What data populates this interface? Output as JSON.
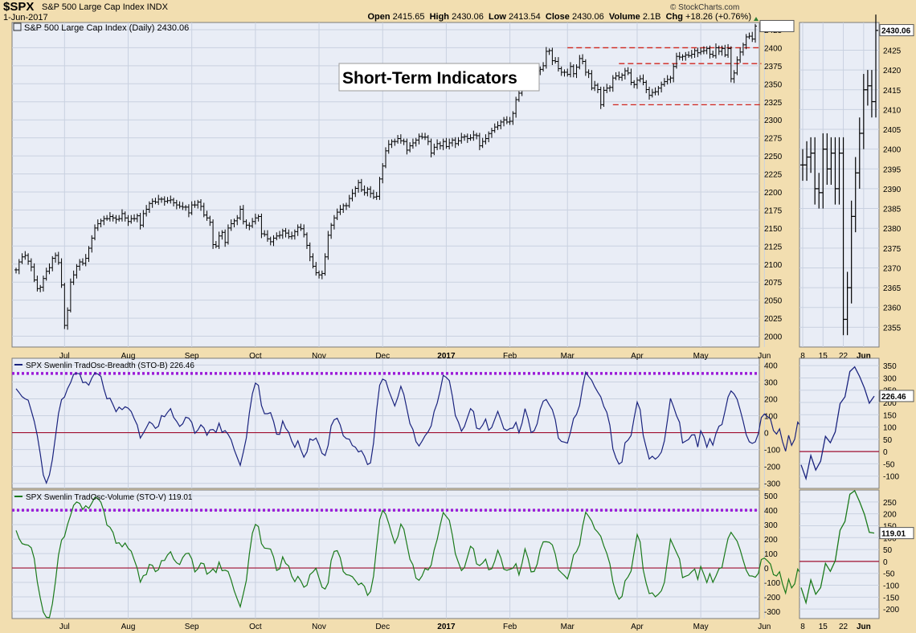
{
  "header": {
    "symbol": "$SPX",
    "name": "S&P 500 Large Cap Index  INDX",
    "date": "1-Jun-2017",
    "open_label": "Open",
    "open": "2415.65",
    "high_label": "High",
    "high": "2430.06",
    "low_label": "Low",
    "low": "2413.54",
    "close_label": "Close",
    "close": "2430.06",
    "volume_label": "Volume",
    "volume": "2.1B",
    "chg_label": "Chg",
    "chg": "+18.26 (+0.76%)",
    "brand": "© StockCharts.com"
  },
  "chart_data": [
    {
      "type": "ohlc",
      "title": "S&P 500 Large Cap Index (Daily) 2430.06",
      "annotation": "Short-Term Indicators",
      "x_labels": [
        "Jul",
        "Aug",
        "Sep",
        "Oct",
        "Nov",
        "Dec",
        "2017",
        "Feb",
        "Mar",
        "Apr",
        "May",
        "Jun"
      ],
      "ylim": [
        1985,
        2435
      ],
      "y_ticks": [
        2000,
        2025,
        2050,
        2075,
        2100,
        2125,
        2150,
        2175,
        2200,
        2225,
        2250,
        2275,
        2300,
        2325,
        2350,
        2375,
        2400,
        2425
      ],
      "grid": true,
      "last_value": 2430.06,
      "closes": [
        2092,
        2103,
        2110,
        2112,
        2104,
        2096,
        2078,
        2066,
        2068,
        2080,
        2090,
        2095,
        2108,
        2112,
        2102,
        2071,
        2015,
        2036,
        2075,
        2085,
        2097,
        2103,
        2101,
        2108,
        2122,
        2136,
        2150,
        2156,
        2160,
        2163,
        2163,
        2166,
        2164,
        2162,
        2163,
        2170,
        2164,
        2159,
        2163,
        2163,
        2167,
        2154,
        2170,
        2176,
        2184,
        2187,
        2186,
        2190,
        2190,
        2187,
        2188,
        2189,
        2185,
        2182,
        2180,
        2179,
        2179,
        2171,
        2182,
        2182,
        2186,
        2180,
        2168,
        2164,
        2158,
        2127,
        2125,
        2139,
        2144,
        2130,
        2150,
        2156,
        2160,
        2164,
        2176,
        2159,
        2154,
        2153,
        2159,
        2164,
        2166,
        2142,
        2141,
        2135,
        2131,
        2136,
        2139,
        2140,
        2146,
        2143,
        2138,
        2139,
        2145,
        2151,
        2149,
        2141,
        2126,
        2110,
        2097,
        2088,
        2085,
        2087,
        2110,
        2140,
        2154,
        2164,
        2172,
        2176,
        2181,
        2181,
        2191,
        2198,
        2205,
        2213,
        2203,
        2199,
        2204,
        2198,
        2193,
        2194,
        2218,
        2236,
        2257,
        2266,
        2270,
        2270,
        2274,
        2271,
        2270,
        2258,
        2264,
        2268,
        2272,
        2277,
        2276,
        2276,
        2270,
        2254,
        2262,
        2267,
        2264,
        2270,
        2263,
        2268,
        2272,
        2267,
        2271,
        2276,
        2277,
        2274,
        2275,
        2279,
        2278,
        2264,
        2270,
        2274,
        2281,
        2285,
        2290,
        2292,
        2297,
        2300,
        2297,
        2298,
        2309,
        2328,
        2337,
        2345,
        2352,
        2365,
        2363,
        2367,
        2368,
        2370,
        2375,
        2395,
        2396,
        2382,
        2381,
        2371,
        2366,
        2366,
        2363,
        2374,
        2364,
        2373,
        2385,
        2381,
        2366,
        2364,
        2344,
        2348,
        2342,
        2321,
        2341,
        2344,
        2345,
        2358,
        2361,
        2359,
        2362,
        2368,
        2365,
        2352,
        2349,
        2355,
        2357,
        2352,
        2342,
        2334,
        2338,
        2339,
        2344,
        2349,
        2353,
        2356,
        2358,
        2374,
        2388,
        2387,
        2388,
        2390,
        2389,
        2391,
        2396,
        2393,
        2395,
        2396,
        2399,
        2391,
        2389,
        2400,
        2395,
        2399,
        2390,
        2399,
        2357,
        2365,
        2383,
        2394,
        2404,
        2415,
        2416,
        2412,
        2430
      ]
    },
    {
      "type": "line",
      "title": "SPX Swenlin TradOsc-Breadth (STO-B) 226.46",
      "ylim": [
        -330,
        440
      ],
      "y_ticks": [
        -300,
        -200,
        -100,
        0,
        100,
        200,
        300,
        400
      ],
      "zero_line": 0,
      "threshold_line": 350,
      "last_value": 226.46,
      "values": [
        260,
        237,
        213,
        200,
        192,
        130,
        68,
        -17,
        -128,
        -250,
        -298,
        -250,
        -159,
        -25,
        113,
        195,
        211,
        261,
        296,
        345,
        351,
        348,
        296,
        299,
        281,
        323,
        353,
        347,
        333,
        259,
        200,
        204,
        165,
        124,
        151,
        136,
        153,
        145,
        125,
        83,
        45,
        -32,
        -3,
        29,
        64,
        51,
        25,
        38,
        101,
        94,
        120,
        142,
        90,
        67,
        37,
        52,
        91,
        86,
        60,
        -4,
        15,
        46,
        28,
        -16,
        16,
        19,
        2,
        56,
        2,
        12,
        -10,
        -43,
        -101,
        -147,
        -193,
        -116,
        -31,
        115,
        230,
        293,
        280,
        161,
        112,
        112,
        118,
        66,
        -9,
        -10,
        69,
        26,
        2,
        -50,
        -87,
        -48,
        -101,
        -145,
        -114,
        -37,
        -46,
        -32,
        -72,
        -123,
        -135,
        -75,
        40,
        76,
        85,
        46,
        -18,
        -35,
        -39,
        -76,
        -86,
        -114,
        -107,
        -140,
        -189,
        -179,
        -61,
        132,
        281,
        317,
        308,
        249,
        204,
        158,
        209,
        274,
        226,
        140,
        53,
        19,
        -53,
        -79,
        -51,
        -18,
        5,
        40,
        125,
        175,
        251,
        339,
        327,
        308,
        215,
        101,
        62,
        9,
        36,
        90,
        142,
        125,
        27,
        21,
        45,
        80,
        14,
        31,
        78,
        126,
        76,
        23,
        13,
        24,
        27,
        61,
        0,
        56,
        142,
        83,
        1,
        11,
        52,
        138,
        186,
        196,
        165,
        136,
        76,
        -32,
        -52,
        -56,
        -62,
        3,
        83,
        108,
        161,
        270,
        358,
        332,
        310,
        271,
        240,
        212,
        155,
        120,
        44,
        -97,
        -150,
        -186,
        -174,
        -60,
        -44,
        -17,
        87,
        181,
        136,
        -16,
        -89,
        -156,
        -140,
        -157,
        -142,
        -115,
        -48,
        75,
        203,
        154,
        100,
        61,
        -61,
        -50,
        -40,
        -14,
        -13,
        -85,
        11,
        -26,
        -86,
        -36,
        -74,
        -6,
        38,
        48,
        127,
        211,
        247,
        229,
        197,
        136,
        67,
        -12,
        -54,
        -64,
        -55,
        -6,
        89,
        110,
        95,
        80,
        12,
        -8,
        22,
        -54,
        -110,
        -16,
        -75,
        -39,
        62,
        36,
        80,
        195,
        223,
        326,
        345,
        306,
        258,
        197,
        226
      ]
    },
    {
      "type": "line",
      "title": "SPX Swenlin TradOsc-Volume (STO-V) 119.01",
      "ylim": [
        -350,
        540
      ],
      "y_ticks": [
        -300,
        -200,
        -100,
        0,
        100,
        200,
        300,
        400,
        500
      ],
      "zero_line": 0,
      "threshold_line": 400,
      "last_value": 119.01,
      "values": [
        260,
        203,
        169,
        162,
        158,
        140,
        66,
        -95,
        -209,
        -305,
        -341,
        -343,
        -248,
        -94,
        89,
        193,
        219,
        302,
        366,
        434,
        457,
        447,
        405,
        431,
        413,
        450,
        489,
        482,
        455,
        393,
        297,
        282,
        246,
        171,
        175,
        146,
        173,
        136,
        116,
        57,
        -2,
        -98,
        -53,
        -46,
        25,
        19,
        -25,
        -12,
        51,
        52,
        90,
        113,
        62,
        36,
        24,
        72,
        99,
        102,
        62,
        -27,
        -7,
        35,
        29,
        -43,
        -28,
        -6,
        -31,
        41,
        -19,
        -15,
        -24,
        -84,
        -158,
        -214,
        -269,
        -180,
        -86,
        95,
        241,
        302,
        287,
        169,
        138,
        135,
        131,
        76,
        -17,
        -6,
        77,
        31,
        14,
        -57,
        -94,
        -58,
        -89,
        -133,
        -119,
        -46,
        -27,
        -2,
        -69,
        -133,
        -146,
        -104,
        52,
        115,
        120,
        72,
        -24,
        -46,
        -50,
        -60,
        -88,
        -117,
        -104,
        -127,
        -189,
        -163,
        -56,
        148,
        335,
        398,
        373,
        309,
        237,
        171,
        216,
        304,
        269,
        164,
        60,
        22,
        -70,
        -85,
        -56,
        -4,
        -14,
        20,
        124,
        198,
        298,
        384,
        357,
        331,
        227,
        99,
        39,
        -18,
        4,
        77,
        150,
        133,
        29,
        17,
        35,
        61,
        -13,
        -5,
        47,
        122,
        71,
        -8,
        -16,
        -9,
        -1,
        30,
        -48,
        32,
        132,
        66,
        -27,
        -24,
        26,
        128,
        181,
        182,
        178,
        160,
        95,
        -12,
        -33,
        -53,
        -76,
        -7,
        90,
        114,
        161,
        290,
        386,
        358,
        325,
        271,
        248,
        219,
        153,
        101,
        29,
        -97,
        -175,
        -216,
        -197,
        -89,
        -62,
        -21,
        109,
        232,
        180,
        -12,
        -107,
        -177,
        -172,
        -200,
        -182,
        -158,
        -99,
        53,
        199,
        153,
        106,
        62,
        -67,
        -57,
        -49,
        -26,
        -7,
        -79,
        11,
        -43,
        -101,
        -39,
        -99,
        -56,
        -5,
        4,
        107,
        205,
        247,
        216,
        185,
        127,
        54,
        -15,
        -54,
        -56,
        -64,
        -37,
        59,
        69,
        50,
        27,
        -46,
        -55,
        -26,
        -110,
        -174,
        -78,
        -138,
        -110,
        -8,
        -42,
        3,
        131,
        168,
        282,
        297,
        251,
        197,
        122,
        119
      ]
    }
  ],
  "side_charts": [
    {
      "x_labels": [
        "8",
        "15",
        "22",
        "Jun"
      ],
      "ylim": [
        2350,
        2432
      ],
      "y_ticks": [
        2355,
        2360,
        2365,
        2370,
        2375,
        2380,
        2385,
        2390,
        2395,
        2400,
        2405,
        2410,
        2415,
        2420,
        2425
      ],
      "last_value": "2430.06",
      "closes": [
        2396,
        2398,
        2399,
        2390,
        2389,
        2400,
        2395,
        2399,
        2390,
        2399,
        2357,
        2365,
        2383,
        2394,
        2404,
        2415,
        2416,
        2412,
        2430
      ]
    },
    {
      "ylim": [
        -150,
        380
      ],
      "y_ticks": [
        -100,
        -50,
        0,
        50,
        100,
        150,
        200,
        250,
        300,
        350
      ],
      "zero_line": 0,
      "last_value": "226.46",
      "values": [
        -54,
        -110,
        -16,
        -75,
        -39,
        62,
        36,
        80,
        195,
        223,
        326,
        345,
        306,
        258,
        197,
        226
      ]
    },
    {
      "ylim": [
        -240,
        300
      ],
      "y_ticks": [
        -200,
        -150,
        -100,
        -50,
        0,
        50,
        100,
        150,
        200,
        250
      ],
      "zero_line": 0,
      "last_value": "119.01",
      "values": [
        -110,
        -174,
        -78,
        -138,
        -110,
        -8,
        -42,
        3,
        131,
        168,
        282,
        297,
        251,
        197,
        122,
        119
      ]
    }
  ],
  "colors": {
    "background": "#f2deb0",
    "panel": "#e9edf6",
    "grid": "#c9d1e0",
    "price": "#000000",
    "breadth": "#1a237e",
    "volume": "#1b7a1b",
    "zero": "#a11030",
    "threshold": "#9b1bd8",
    "resistance": "#d0241c"
  }
}
